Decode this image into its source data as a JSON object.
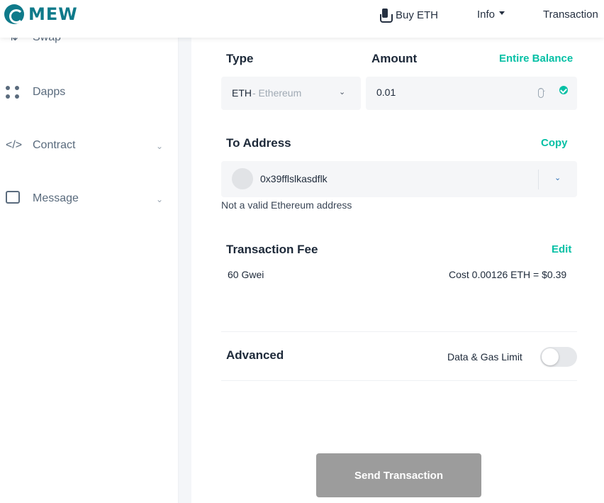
{
  "header": {
    "brand": "MEW",
    "nav": [
      {
        "label": "Buy ETH"
      },
      {
        "label": "Info"
      },
      {
        "label": "Transaction"
      }
    ]
  },
  "sidebar": {
    "items": [
      {
        "label": "Swap",
        "icon": "swap-icon"
      },
      {
        "label": "Dapps",
        "icon": "dapps-icon"
      },
      {
        "label": "Contract",
        "icon": "code-icon",
        "expandable": true
      },
      {
        "label": "Message",
        "icon": "message-icon",
        "expandable": true
      }
    ]
  },
  "form": {
    "type_label": "Type",
    "amount_label": "Amount",
    "entire_balance": "Entire Balance",
    "token_symbol": "ETH",
    "token_name": "- Ethereum",
    "amount_value": "0.01",
    "to_address_label": "To Address",
    "copy_label": "Copy",
    "address_value": "0x39fflslkasdflk",
    "address_error": "Not a valid Ethereum address",
    "fee_label": "Transaction Fee",
    "edit_label": "Edit",
    "gas_price": "60 Gwei",
    "cost": "Cost 0.00126 ETH = $0.39",
    "advanced_label": "Advanced",
    "data_gas_label": "Data & Gas Limit",
    "data_gas_enabled": false,
    "send_label": "Send Transaction"
  },
  "colors": {
    "accent": "#05c0a5",
    "brand": "#0f7a8a",
    "button_disabled": "#9c9c9c"
  }
}
